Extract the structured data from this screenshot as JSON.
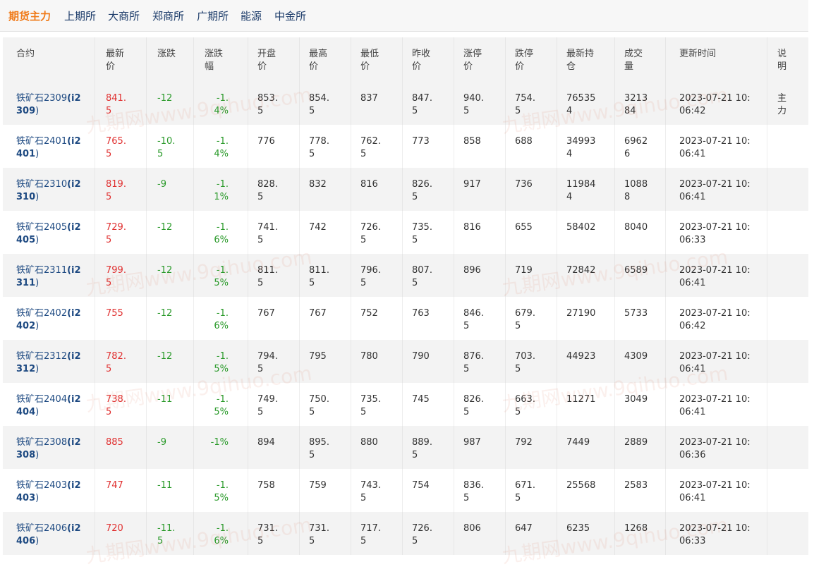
{
  "tabs": [
    {
      "label": "期货主力",
      "active": true
    },
    {
      "label": "上期所",
      "active": false
    },
    {
      "label": "大商所",
      "active": false
    },
    {
      "label": "郑商所",
      "active": false
    },
    {
      "label": "广期所",
      "active": false
    },
    {
      "label": "能源",
      "active": false
    },
    {
      "label": "中金所",
      "active": false
    }
  ],
  "table": {
    "headers": {
      "contract": [
        "合约"
      ],
      "last": [
        "最新",
        "价"
      ],
      "change": [
        "涨跌"
      ],
      "pct": [
        "涨跌",
        "幅"
      ],
      "open": [
        "开盘",
        "价"
      ],
      "high": [
        "最高",
        "价"
      ],
      "low": [
        "最低",
        "价"
      ],
      "prev": [
        "昨收",
        "价"
      ],
      "limitup": [
        "涨停",
        "价"
      ],
      "limitdown": [
        "跌停",
        "价"
      ],
      "oi": [
        "最新持",
        "仓"
      ],
      "volume": [
        "成交",
        "量"
      ],
      "time": [
        "更新时间"
      ],
      "note": [
        "说",
        "明"
      ]
    },
    "rows": [
      {
        "name": "铁矿石2309",
        "code": "(i2",
        "code2": "309",
        "code3": ")",
        "last": [
          "841.",
          "5"
        ],
        "change": [
          "-12"
        ],
        "pct": [
          "-1.",
          "4%"
        ],
        "open": [
          "853.",
          "5"
        ],
        "high": [
          "854.",
          "5"
        ],
        "low": [
          "837"
        ],
        "prev": [
          "847.",
          "5"
        ],
        "limitup": [
          "940.",
          "5"
        ],
        "limitdown": [
          "754.",
          "5"
        ],
        "oi": [
          "76535",
          "4"
        ],
        "volume": [
          "3213",
          "84"
        ],
        "time": [
          "2023-07-21 10:",
          "06:42"
        ],
        "note": [
          "主",
          "力"
        ]
      },
      {
        "name": "铁矿石2401",
        "code": "(i2",
        "code2": "401",
        "code3": ")",
        "last": [
          "765.",
          "5"
        ],
        "change": [
          "-10.",
          "5"
        ],
        "pct": [
          "-1.",
          "4%"
        ],
        "open": [
          "776"
        ],
        "high": [
          "778.",
          "5"
        ],
        "low": [
          "762.",
          "5"
        ],
        "prev": [
          "773"
        ],
        "limitup": [
          "858"
        ],
        "limitdown": [
          "688"
        ],
        "oi": [
          "34993",
          "4"
        ],
        "volume": [
          "6962",
          "6"
        ],
        "time": [
          "2023-07-21 10:",
          "06:41"
        ],
        "note": []
      },
      {
        "name": "铁矿石2310",
        "code": "(i2",
        "code2": "310",
        "code3": ")",
        "last": [
          "819.",
          "5"
        ],
        "change": [
          "-9"
        ],
        "pct": [
          "-1.",
          "1%"
        ],
        "open": [
          "828.",
          "5"
        ],
        "high": [
          "832"
        ],
        "low": [
          "816"
        ],
        "prev": [
          "826.",
          "5"
        ],
        "limitup": [
          "917"
        ],
        "limitdown": [
          "736"
        ],
        "oi": [
          "11984",
          "4"
        ],
        "volume": [
          "1088",
          "8"
        ],
        "time": [
          "2023-07-21 10:",
          "06:41"
        ],
        "note": []
      },
      {
        "name": "铁矿石2405",
        "code": "(i2",
        "code2": "405",
        "code3": ")",
        "last": [
          "729.",
          "5"
        ],
        "change": [
          "-12"
        ],
        "pct": [
          "-1.",
          "6%"
        ],
        "open": [
          "741.",
          "5"
        ],
        "high": [
          "742"
        ],
        "low": [
          "726.",
          "5"
        ],
        "prev": [
          "735.",
          "5"
        ],
        "limitup": [
          "816"
        ],
        "limitdown": [
          "655"
        ],
        "oi": [
          "58402"
        ],
        "volume": [
          "8040"
        ],
        "time": [
          "2023-07-21 10:",
          "06:33"
        ],
        "note": []
      },
      {
        "name": "铁矿石2311",
        "code": "(i2",
        "code2": "311",
        "code3": ")",
        "last": [
          "799.",
          "5"
        ],
        "change": [
          "-12"
        ],
        "pct": [
          "-1.",
          "5%"
        ],
        "open": [
          "811.",
          "5"
        ],
        "high": [
          "811.",
          "5"
        ],
        "low": [
          "796.",
          "5"
        ],
        "prev": [
          "807.",
          "5"
        ],
        "limitup": [
          "896"
        ],
        "limitdown": [
          "719"
        ],
        "oi": [
          "72842"
        ],
        "volume": [
          "6589"
        ],
        "time": [
          "2023-07-21 10:",
          "06:41"
        ],
        "note": []
      },
      {
        "name": "铁矿石2402",
        "code": "(i2",
        "code2": "402",
        "code3": ")",
        "last": [
          "755"
        ],
        "change": [
          "-12"
        ],
        "pct": [
          "-1.",
          "6%"
        ],
        "open": [
          "767"
        ],
        "high": [
          "767"
        ],
        "low": [
          "752"
        ],
        "prev": [
          "763"
        ],
        "limitup": [
          "846.",
          "5"
        ],
        "limitdown": [
          "679.",
          "5"
        ],
        "oi": [
          "27190"
        ],
        "volume": [
          "5733"
        ],
        "time": [
          "2023-07-21 10:",
          "06:42"
        ],
        "note": []
      },
      {
        "name": "铁矿石2312",
        "code": "(i2",
        "code2": "312",
        "code3": ")",
        "last": [
          "782.",
          "5"
        ],
        "change": [
          "-12"
        ],
        "pct": [
          "-1.",
          "5%"
        ],
        "open": [
          "794.",
          "5"
        ],
        "high": [
          "795"
        ],
        "low": [
          "780"
        ],
        "prev": [
          "790"
        ],
        "limitup": [
          "876.",
          "5"
        ],
        "limitdown": [
          "703.",
          "5"
        ],
        "oi": [
          "44923"
        ],
        "volume": [
          "4309"
        ],
        "time": [
          "2023-07-21 10:",
          "06:41"
        ],
        "note": []
      },
      {
        "name": "铁矿石2404",
        "code": "(i2",
        "code2": "404",
        "code3": ")",
        "last": [
          "738.",
          "5"
        ],
        "change": [
          "-11"
        ],
        "pct": [
          "-1.",
          "5%"
        ],
        "open": [
          "749.",
          "5"
        ],
        "high": [
          "750.",
          "5"
        ],
        "low": [
          "735.",
          "5"
        ],
        "prev": [
          "745"
        ],
        "limitup": [
          "826.",
          "5"
        ],
        "limitdown": [
          "663.",
          "5"
        ],
        "oi": [
          "11271"
        ],
        "volume": [
          "3049"
        ],
        "time": [
          "2023-07-21 10:",
          "06:41"
        ],
        "note": []
      },
      {
        "name": "铁矿石2308",
        "code": "(i2",
        "code2": "308",
        "code3": ")",
        "last": [
          "885"
        ],
        "change": [
          "-9"
        ],
        "pct": [
          "-1%"
        ],
        "open": [
          "894"
        ],
        "high": [
          "895.",
          "5"
        ],
        "low": [
          "880"
        ],
        "prev": [
          "889.",
          "5"
        ],
        "limitup": [
          "987"
        ],
        "limitdown": [
          "792"
        ],
        "oi": [
          "7449"
        ],
        "volume": [
          "2889"
        ],
        "time": [
          "2023-07-21 10:",
          "06:36"
        ],
        "note": []
      },
      {
        "name": "铁矿石2403",
        "code": "(i2",
        "code2": "403",
        "code3": ")",
        "last": [
          "747"
        ],
        "change": [
          "-11"
        ],
        "pct": [
          "-1.",
          "5%"
        ],
        "open": [
          "758"
        ],
        "high": [
          "759"
        ],
        "low": [
          "743.",
          "5"
        ],
        "prev": [
          "754"
        ],
        "limitup": [
          "836.",
          "5"
        ],
        "limitdown": [
          "671.",
          "5"
        ],
        "oi": [
          "25568"
        ],
        "volume": [
          "2583"
        ],
        "time": [
          "2023-07-21 10:",
          "06:41"
        ],
        "note": []
      },
      {
        "name": "铁矿石2406",
        "code": "(i2",
        "code2": "406",
        "code3": ")",
        "last": [
          "720"
        ],
        "change": [
          "-11.",
          "5"
        ],
        "pct": [
          "-1.",
          "6%"
        ],
        "open": [
          "731.",
          "5"
        ],
        "high": [
          "731.",
          "5"
        ],
        "low": [
          "717.",
          "5"
        ],
        "prev": [
          "726.",
          "5"
        ],
        "limitup": [
          "806"
        ],
        "limitdown": [
          "647"
        ],
        "oi": [
          "6235"
        ],
        "volume": [
          "1268"
        ],
        "time": [
          "2023-07-21 10:",
          "06:33"
        ],
        "note": []
      }
    ]
  },
  "watermark": "九期网www.9qihuo.com",
  "colors": {
    "active_tab": "#f07a18",
    "tab": "#1e3d6b",
    "up": "#e03030",
    "down": "#2a9a2a",
    "contract": "#1e4a82"
  }
}
